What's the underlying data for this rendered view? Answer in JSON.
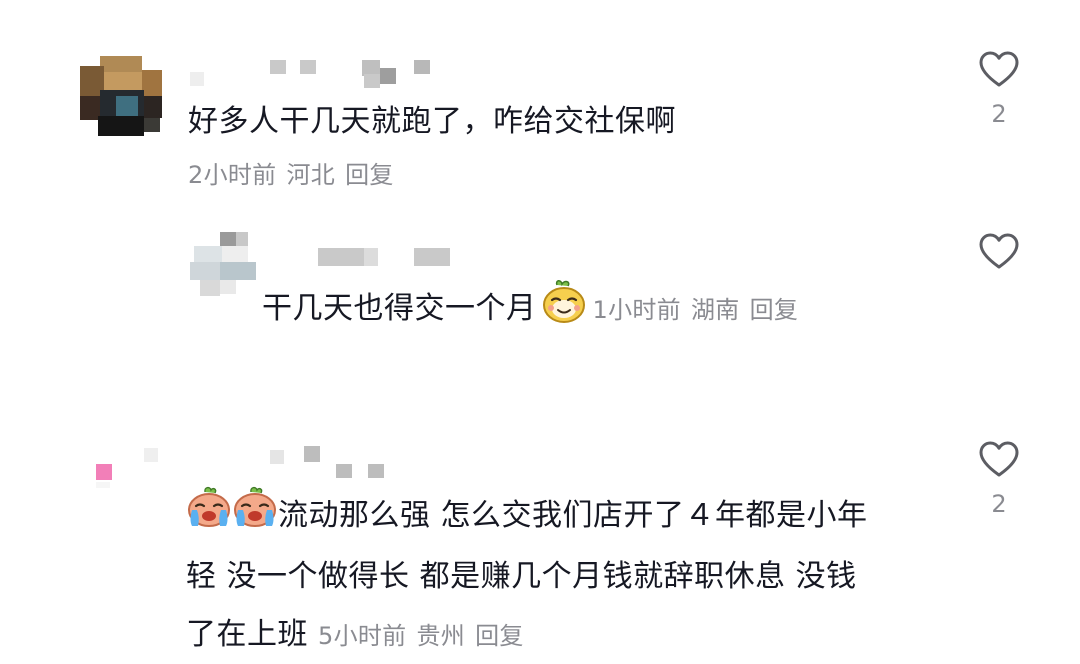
{
  "comments": [
    {
      "text": "好多人干几天就跑了，咋给交社保啊",
      "time": "2小时前",
      "location": "河北",
      "reply_label": "回复",
      "like_count": "2",
      "avatar_icon": "pixelated-avatar"
    },
    {
      "text": "干几天也得交一个月",
      "time": "1小时前",
      "location": "湖南",
      "reply_label": "回复",
      "like_count": "",
      "avatar_icon": "pixelated-avatar",
      "emoji": "smirk-emoji"
    },
    {
      "text_line1": "流动那么强 怎么交我们店开了４年都是小年",
      "text_line2": "轻 没一个做得长 都是赚几个月钱就辞职休息 没钱",
      "text_line3": "了在上班",
      "time": "5小时前",
      "location": "贵州",
      "reply_label": "回复",
      "like_count": "2",
      "avatar_icon": "pixelated-avatar",
      "emoji": "crying-emoji"
    }
  ],
  "icons": {
    "like": "heart-outline-icon"
  },
  "colors": {
    "text": "#161823",
    "meta": "#8a8b91",
    "heart_stroke": "#5c5d63"
  }
}
